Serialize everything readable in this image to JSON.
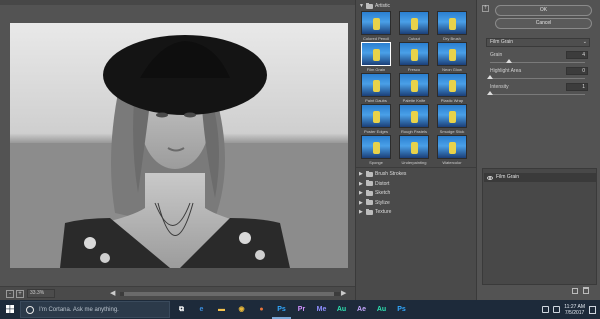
{
  "preview": {
    "zoom_level": "33.3%",
    "minus_label": "-",
    "plus_label": "+",
    "scroll_left": "◀",
    "scroll_right": "▶"
  },
  "filter_browser": {
    "open_folder": "Artistic",
    "filters": [
      {
        "label": "Colored Pencil",
        "selected": false
      },
      {
        "label": "Cutout",
        "selected": false
      },
      {
        "label": "Dry Brush",
        "selected": false
      },
      {
        "label": "Film Grain",
        "selected": true
      },
      {
        "label": "Fresco",
        "selected": false
      },
      {
        "label": "Neon Glow",
        "selected": false
      },
      {
        "label": "Paint Daubs",
        "selected": false
      },
      {
        "label": "Palette Knife",
        "selected": false
      },
      {
        "label": "Plastic Wrap",
        "selected": false
      },
      {
        "label": "Poster Edges",
        "selected": false
      },
      {
        "label": "Rough Pastels",
        "selected": false
      },
      {
        "label": "Smudge Stick",
        "selected": false
      },
      {
        "label": "Sponge",
        "selected": false
      },
      {
        "label": "Underpainting",
        "selected": false
      },
      {
        "label": "Watercolor",
        "selected": false
      }
    ],
    "folders": [
      "Brush Strokes",
      "Distort",
      "Sketch",
      "Stylize",
      "Texture"
    ]
  },
  "settings": {
    "ok_label": "OK",
    "cancel_label": "Cancel",
    "filter_name": "Film Grain",
    "params": [
      {
        "label": "Grain",
        "value": "4",
        "fraction": 0.2
      },
      {
        "label": "Highlight Area",
        "value": "0",
        "fraction": 0.0
      },
      {
        "label": "Intensity",
        "value": "1",
        "fraction": 0.0
      }
    ],
    "layer_name": "Film Grain"
  },
  "taskbar": {
    "search_placeholder": "I'm Cortana. Ask me anything.",
    "time": "11:27 AM",
    "date": "7/5/2017",
    "apps": [
      {
        "name": "task-view-icon",
        "glyph": "⧉",
        "color": "#ffffff"
      },
      {
        "name": "edge-icon",
        "glyph": "e",
        "color": "#3b8fe0"
      },
      {
        "name": "file-explorer-icon",
        "glyph": "▬",
        "color": "#f2c14e"
      },
      {
        "name": "chrome-icon",
        "glyph": "◉",
        "color": "#e8b83a"
      },
      {
        "name": "firefox-icon",
        "glyph": "●",
        "color": "#e8743a"
      },
      {
        "name": "photoshop-icon",
        "glyph": "Ps",
        "color": "#31a8ff"
      },
      {
        "name": "premiere-icon",
        "glyph": "Pr",
        "color": "#d291ff"
      },
      {
        "name": "media-encoder-icon",
        "glyph": "Me",
        "color": "#8f8fff"
      },
      {
        "name": "audition-icon",
        "glyph": "Au",
        "color": "#2fe0b0"
      },
      {
        "name": "after-effects-icon",
        "glyph": "Ae",
        "color": "#c6a8ff"
      },
      {
        "name": "audition-2-icon",
        "glyph": "Au",
        "color": "#2fe0b0"
      },
      {
        "name": "photoshop-2-icon",
        "glyph": "Ps",
        "color": "#31a8ff"
      }
    ]
  }
}
